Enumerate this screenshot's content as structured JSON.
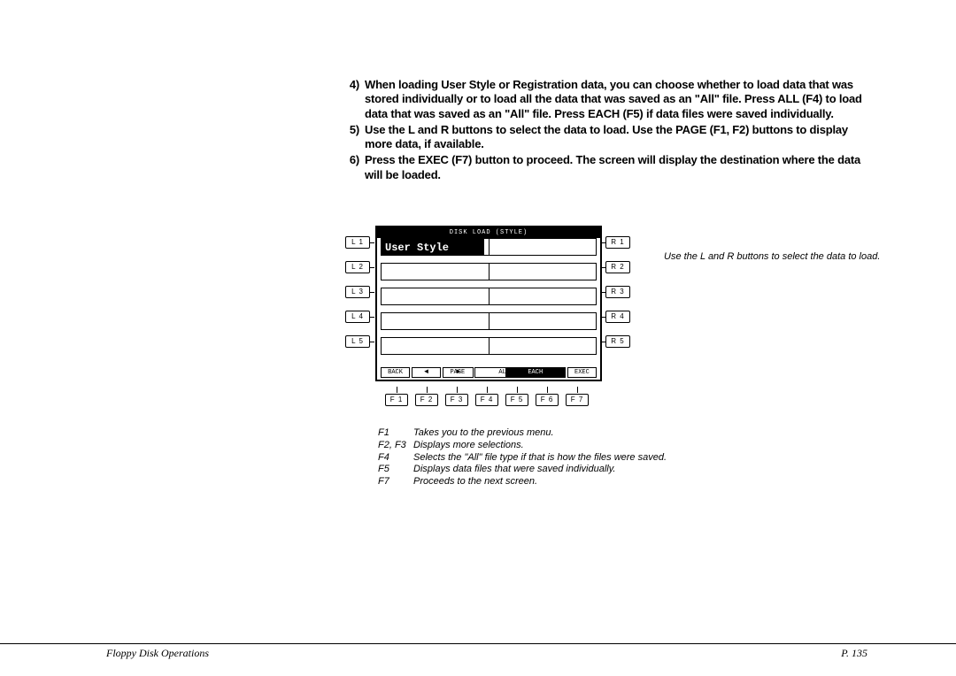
{
  "instructions": [
    {
      "num": "4)",
      "text": "When loading User Style or Registration data, you can choose whether to load data that was stored individually or to load all the data that was saved as an \"All\" file.  Press ALL (F4) to load data that was saved as an \"All\" file.  Press EACH (F5) if data files were saved individually."
    },
    {
      "num": "5)",
      "text": "Use the L and R buttons to select the data to load.  Use the PAGE (F1, F2) buttons to display more data, if available."
    },
    {
      "num": "6)",
      "text": "Press the EXEC (F7) button to proceed.  The screen will display the destination where the data will be loaded."
    }
  ],
  "screen": {
    "title": "DISK LOAD (STYLE)",
    "selected_item": "User Style",
    "bottom_buttons": [
      "BACK",
      "◄",
      "PAGE",
      "►",
      "ALL",
      "EACH",
      "",
      "EXEC"
    ]
  },
  "side_labels": {
    "left": [
      "L 1",
      "L 2",
      "L 3",
      "L 4",
      "L 5"
    ],
    "right": [
      "R 1",
      "R 2",
      "R 3",
      "R 4",
      "R 5"
    ]
  },
  "f_labels": [
    "F 1",
    "F 2",
    "F 3",
    "F 4",
    "F 5",
    "F 6",
    "F 7"
  ],
  "side_caption": "Use the L and R buttons to select the data to load.",
  "f_legend": [
    {
      "k": "F1",
      "d": "Takes you to the previous menu."
    },
    {
      "k": "F2, F3",
      "d": "Displays more selections."
    },
    {
      "k": "F4",
      "d": "Selects the \"All\" file type if that is how the files were saved."
    },
    {
      "k": "F5",
      "d": "Displays data files that were saved individually."
    },
    {
      "k": "F7",
      "d": "Proceeds to the next screen."
    }
  ],
  "footer": {
    "left": "Floppy Disk Operations",
    "right": "P. 135"
  }
}
